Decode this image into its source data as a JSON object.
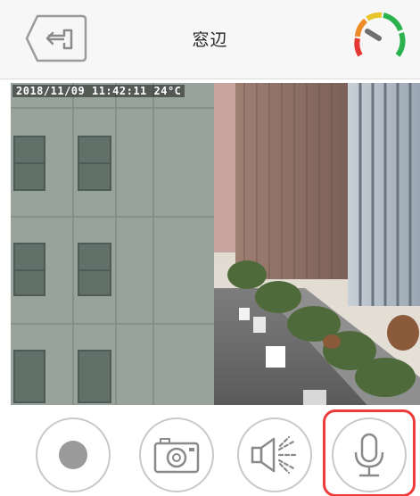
{
  "header": {
    "title": "窓辺",
    "back_icon": "back-arrow-icon",
    "signal_icon": "signal-gauge-icon"
  },
  "feed": {
    "overlay_text": "2018/11/09 11:42:11 24°C"
  },
  "controls": {
    "items": [
      {
        "name": "record",
        "icon": "record-icon"
      },
      {
        "name": "snapshot",
        "icon": "camera-icon"
      },
      {
        "name": "speaker",
        "icon": "speaker-icon"
      },
      {
        "name": "microphone",
        "icon": "microphone-icon"
      }
    ],
    "highlight_color": "#ef3b3b"
  },
  "colors": {
    "gauge_green": "#2bb24c",
    "gauge_yellow": "#e8c62a",
    "gauge_orange": "#f08a24",
    "gauge_red": "#e53935"
  }
}
